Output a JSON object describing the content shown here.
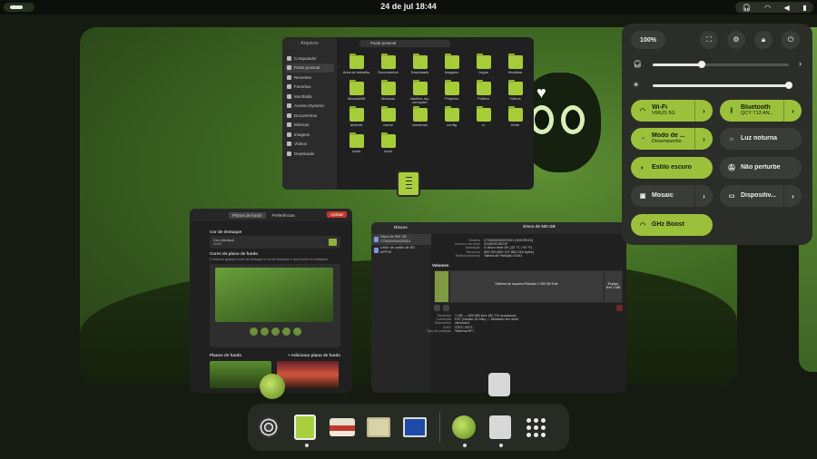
{
  "topbar": {
    "clock": "24 de jul  18:44",
    "tray_icons": [
      "headphones-icon",
      "wifi-icon",
      "volume-icon",
      "battery-icon"
    ]
  },
  "files_window": {
    "sidebar_title": "Arquivos",
    "path": "Pasta pessoal",
    "sidebar": [
      "Computador",
      "Pasta pessoal",
      "Recentes",
      "Favoritos",
      "Montfalda",
      "Acesso Dynamic",
      "Documentos",
      "Músicas",
      "Imagens",
      "Vídeos",
      "Downloads"
    ],
    "folders": [
      "Área de trabalho",
      "Documentos",
      "Downloads",
      "Imagens",
      "Jogos",
      "Modelos",
      "MosaicMM",
      "Músicas",
      "nautilus-my-computer",
      "Projetos",
      "Público",
      "Vídeos",
      "android",
      "cache",
      "cinnamon",
      "config",
      "cr",
      "fonts",
      "icons",
      "local"
    ]
  },
  "settings_window": {
    "tabs": [
      "Planos de fundo",
      "Preferências"
    ],
    "apply": "Aplicar",
    "section1_title": "Cor de destaque",
    "accent_label": "Cor principal",
    "accent_sub": "Verde",
    "section2_title": "Cores do plano de fundo",
    "section2_desc": "O sistema ajustará cores de destaque a cor de destaque e dos ícones em wallpaper",
    "backgrounds_label": "Planos de fundo",
    "add_background": "Adicionar plano de fundo"
  },
  "disks_window": {
    "title_left": "Discos",
    "title_right": "Disco de 500 GB",
    "title_right_sub": "/dev/sda",
    "disk_items": [
      {
        "name": "Disco de 500 GB",
        "sub": "CT500MX500SSD1"
      },
      {
        "name": "Leitor de cartão de SD",
        "sub": "APPLE"
      }
    ],
    "info": [
      {
        "k": "Modelo",
        "v": "CT500MX500SSD1 (M3CR023)"
      },
      {
        "k": "Número de série",
        "v": "2119E5C4E21F"
      },
      {
        "k": "Avaliação",
        "v": "O disco está OK (32 °C / 90 °F)"
      },
      {
        "k": "Tamanho",
        "v": "500 GB (500 107 862 016 bytes)"
      },
      {
        "k": "Particionamento",
        "v": "Tabela de Partição GUID"
      }
    ],
    "volumes_label": "Volumes",
    "vol1": "Sistema de Partição 1 GB",
    "vol2": "Sistema de arquivos Partição 2 499 GB Ext4",
    "vol3": "Espaço livre 1 MB",
    "info2": [
      {
        "k": "Tamanho",
        "v": "1 GB — 500 MB livre (52,7% ocupados)"
      },
      {
        "k": "Conteúdo",
        "v": "FAT (versão 32 bits) — Montado em /boot"
      },
      {
        "k": "Dispositivo",
        "v": "/dev/sda1"
      },
      {
        "k": "UUID",
        "v": "37EC-3D71"
      },
      {
        "k": "Tipo de partição",
        "v": "Sistema EFI"
      }
    ]
  },
  "quick_settings": {
    "battery": "100%",
    "tiles": [
      {
        "label": "Wi-Fi",
        "sub": "VIRUS 5G",
        "on": true,
        "icon": "wifi-icon",
        "arrow": true
      },
      {
        "label": "Bluetooth",
        "sub": "QCY T13 AN...",
        "on": true,
        "icon": "bluetooth-icon",
        "arrow": true
      },
      {
        "label": "Modo de ...",
        "sub": "Desempenho",
        "on": true,
        "icon": "power-mode-icon",
        "arrow": true
      },
      {
        "label": "Luz noturna",
        "sub": "",
        "on": false,
        "icon": "night-light-icon",
        "arrow": false
      },
      {
        "label": "Estilo escuro",
        "sub": "",
        "on": true,
        "icon": "dark-style-icon",
        "arrow": false
      },
      {
        "label": "Não perturbe",
        "sub": "",
        "on": false,
        "icon": "dnd-icon",
        "arrow": false
      },
      {
        "label": "Mosaic",
        "sub": "",
        "on": false,
        "icon": "mosaic-icon",
        "arrow": true
      },
      {
        "label": "Dispositiv...",
        "sub": "",
        "on": false,
        "icon": "devices-icon",
        "arrow": true
      },
      {
        "label": "GHz Boost",
        "sub": "",
        "on": true,
        "icon": "boost-icon",
        "arrow": false
      }
    ],
    "volume_level": 0.36,
    "brightness_level": 1.0
  },
  "dock": {
    "apps": [
      "disco-app-icon",
      "text-editor-icon",
      "tape-app-icon",
      "mail-app-icon",
      "screen-app-icon",
      "gnome-app-icon",
      "disks-app-icon",
      "app-grid-icon"
    ],
    "colors": {
      "accent": "#9bc13c",
      "dock_bg": "#282c26"
    }
  }
}
